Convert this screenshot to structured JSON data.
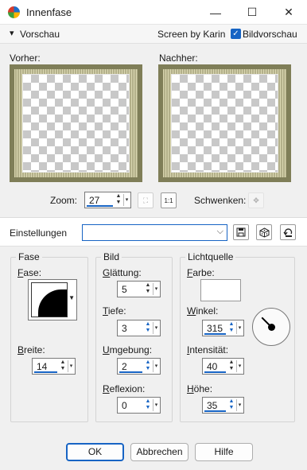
{
  "window": {
    "title": "Innenfase",
    "minimize": "—",
    "maximize": "☐",
    "close": "✕"
  },
  "preview": {
    "toggle": "▾",
    "label": "Vorschau",
    "credit": "Screen by Karin",
    "checkbox": "✓",
    "checkbox_label": "Bildvorschau"
  },
  "panes": {
    "before": "Vorher:",
    "after": "Nachher:"
  },
  "zoom": {
    "label": "Zoom:",
    "value": "27",
    "pan_label": "Schwenken:"
  },
  "settings": {
    "label": "Einstellungen",
    "value": ""
  },
  "fase": {
    "group": "Fase",
    "shape_key": "F",
    "shape_rest": "ase:",
    "width_key": "B",
    "width_rest": "reite:",
    "width_value": "14"
  },
  "bild": {
    "group": "Bild",
    "smooth_key": "G",
    "smooth_rest": "lättung:",
    "smooth_value": "5",
    "depth_key": "T",
    "depth_rest": "iefe:",
    "depth_value": "3",
    "ambience_key": "U",
    "ambience_rest": "mgebung:",
    "ambience_value": "2",
    "reflection_key": "R",
    "reflection_rest": "eflexion:",
    "reflection_value": "0"
  },
  "light": {
    "group": "Lichtquelle",
    "color_key": "F",
    "color_rest": "arbe:",
    "color": "#ffffff",
    "angle_key": "W",
    "angle_rest": "inkel:",
    "angle_value": "315",
    "intensity_key": "I",
    "intensity_rest": "ntensität:",
    "intensity_value": "40",
    "height_key": "H",
    "height_rest": "öhe:",
    "height_value": "35"
  },
  "buttons": {
    "ok": "OK",
    "cancel": "Abbrechen",
    "help": "Hilfe"
  },
  "colors": {
    "accent": "#1764c4",
    "frame": "#7f7e58"
  }
}
